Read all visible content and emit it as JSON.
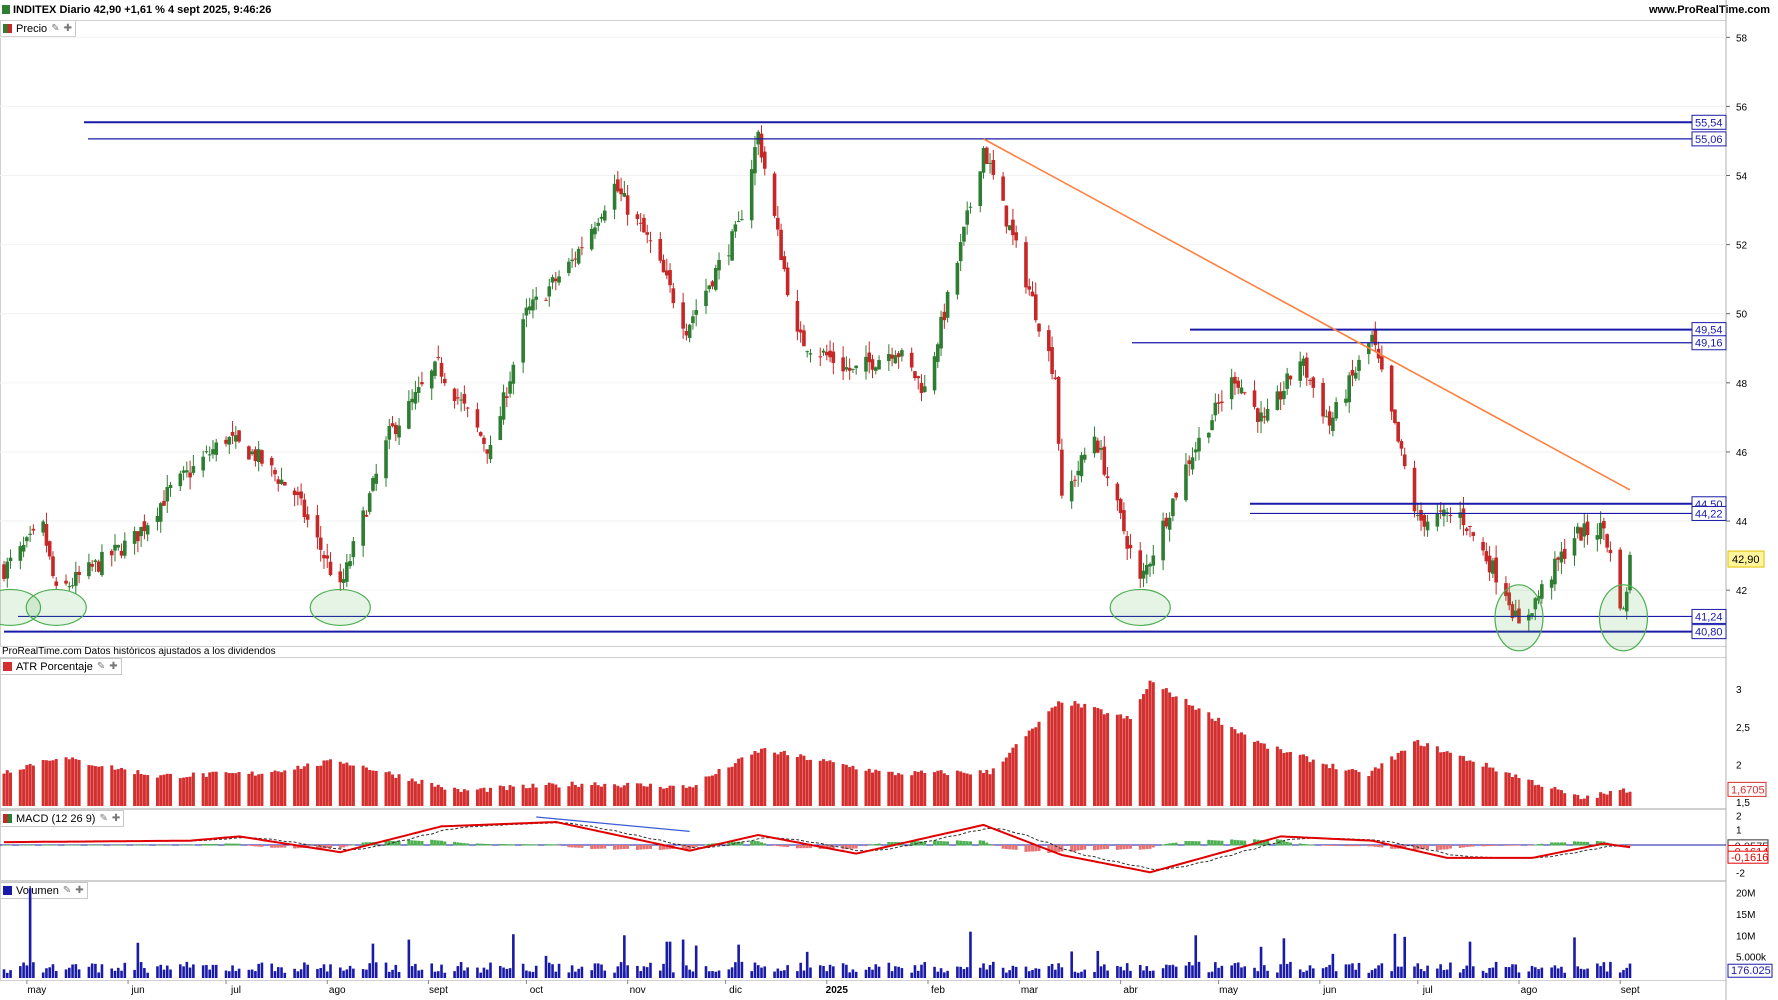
{
  "header": {
    "title": "INDITEX Diario 42,90 +1,61 % 4 sept 2025, 9:46:26",
    "brand": "www.ProRealTime.com"
  },
  "panels": {
    "price_label": "Precio",
    "atr_label": "ATR Porcentaje",
    "macd_label": "MACD (12 26 9)",
    "volume_label": "Volumen",
    "source_note": "ProRealTime.com Datos históricos ajustados a los dividendos"
  },
  "icons": {
    "settings": "wrench-icon",
    "add": "plus-icon"
  },
  "colors": {
    "up": "#2e7d32",
    "down": "#c62828",
    "level": "#1a1aa8",
    "trend": "#ff7f3f",
    "atr": "#d32f2f",
    "volume": "#1a1aa8",
    "support_circle": "#4caf50"
  },
  "x_axis": {
    "labels": [
      "may",
      "jun",
      "jul",
      "ago",
      "sept",
      "oct",
      "nov",
      "dic",
      "2025",
      "feb",
      "mar",
      "abr",
      "may",
      "jun",
      "jul",
      "ago",
      "sept"
    ]
  },
  "price_axis": {
    "ticks": [
      "58",
      "56",
      "54",
      "52",
      "50",
      "48",
      "46",
      "44",
      "42"
    ],
    "level_labels": [
      "55,54",
      "55,06",
      "49,54",
      "49,16",
      "44,50",
      "44,22",
      "41,24",
      "40,80"
    ],
    "current": "42,90"
  },
  "atr_axis": {
    "ticks": [
      "3",
      "2,5",
      "2",
      "1,5"
    ],
    "current": "1,6705"
  },
  "macd_axis": {
    "ticks": [
      "2",
      "1",
      "0",
      "-1",
      "-2"
    ],
    "value_a": "-0,0575",
    "value_b": "-0,1614",
    "value_c": "-0,1616"
  },
  "volume_axis": {
    "ticks": [
      "20M",
      "15M",
      "10M",
      "5.000k"
    ],
    "current": "176.025"
  },
  "chart_data": {
    "type": "candlestick",
    "title": "INDITEX Diario",
    "x_range": [
      "2024-04-24",
      "2025-09-04"
    ],
    "y_range": [
      40.5,
      58.5
    ],
    "levels": [
      55.54,
      55.06,
      49.54,
      49.16,
      44.5,
      44.22,
      41.24,
      40.8
    ],
    "trendline": {
      "from": {
        "date": "2025-02-18",
        "price": 55.06
      },
      "to": {
        "date": "2025-09-04",
        "price": 44.9
      }
    },
    "support_touches": [
      "2024-04-26",
      "2024-05-10",
      "2024-08-05",
      "2025-04-07",
      "2025-08-01",
      "2025-09-02"
    ],
    "close_path": [
      {
        "date": "2024-04-24",
        "close": 42.6
      },
      {
        "date": "2024-05-06",
        "close": 43.8
      },
      {
        "date": "2024-05-10",
        "close": 41.9
      },
      {
        "date": "2024-06-03",
        "close": 43.5
      },
      {
        "date": "2024-06-14",
        "close": 44.9
      },
      {
        "date": "2024-07-01",
        "close": 46.4
      },
      {
        "date": "2024-07-10",
        "close": 45.9
      },
      {
        "date": "2024-07-22",
        "close": 44.8
      },
      {
        "date": "2024-08-05",
        "close": 42.0
      },
      {
        "date": "2024-08-20",
        "close": 46.5
      },
      {
        "date": "2024-09-04",
        "close": 48.5
      },
      {
        "date": "2024-09-20",
        "close": 46.0
      },
      {
        "date": "2024-10-01",
        "close": 50.0
      },
      {
        "date": "2024-10-15",
        "close": 51.5
      },
      {
        "date": "2024-10-28",
        "close": 53.7
      },
      {
        "date": "2024-11-08",
        "close": 52.0
      },
      {
        "date": "2024-11-19",
        "close": 49.6
      },
      {
        "date": "2024-12-05",
        "close": 52.5
      },
      {
        "date": "2024-12-11",
        "close": 55.2
      },
      {
        "date": "2024-12-23",
        "close": 49.3
      },
      {
        "date": "2025-01-09",
        "close": 48.3
      },
      {
        "date": "2025-01-22",
        "close": 49.0
      },
      {
        "date": "2025-01-31",
        "close": 47.8
      },
      {
        "date": "2025-02-10",
        "close": 51.5
      },
      {
        "date": "2025-02-18",
        "close": 54.8
      },
      {
        "date": "2025-03-03",
        "close": 51.0
      },
      {
        "date": "2025-03-12",
        "close": 48.2
      },
      {
        "date": "2025-03-14",
        "close": 44.5
      },
      {
        "date": "2025-03-24",
        "close": 46.5
      },
      {
        "date": "2025-04-07",
        "close": 42.2
      },
      {
        "date": "2025-04-22",
        "close": 45.8
      },
      {
        "date": "2025-05-06",
        "close": 48.2
      },
      {
        "date": "2025-05-15",
        "close": 46.8
      },
      {
        "date": "2025-05-26",
        "close": 48.7
      },
      {
        "date": "2025-06-04",
        "close": 46.8
      },
      {
        "date": "2025-06-17",
        "close": 49.3
      },
      {
        "date": "2025-07-01",
        "close": 44.0
      },
      {
        "date": "2025-07-14",
        "close": 44.2
      },
      {
        "date": "2025-07-28",
        "close": 42.0
      },
      {
        "date": "2025-08-01",
        "close": 40.9
      },
      {
        "date": "2025-08-18",
        "close": 43.6
      },
      {
        "date": "2025-08-27",
        "close": 43.8
      },
      {
        "date": "2025-09-02",
        "close": 41.3
      },
      {
        "date": "2025-09-04",
        "close": 42.9
      }
    ],
    "atr_percent_path": [
      {
        "date": "2024-04-24",
        "value": 1.9
      },
      {
        "date": "2024-05-10",
        "value": 2.1
      },
      {
        "date": "2024-06-10",
        "value": 1.85
      },
      {
        "date": "2024-07-10",
        "value": 1.88
      },
      {
        "date": "2024-08-05",
        "value": 2.05
      },
      {
        "date": "2024-09-10",
        "value": 1.65
      },
      {
        "date": "2024-10-20",
        "value": 1.75
      },
      {
        "date": "2024-11-20",
        "value": 1.7
      },
      {
        "date": "2024-12-12",
        "value": 2.2
      },
      {
        "date": "2025-01-20",
        "value": 1.88
      },
      {
        "date": "2025-02-20",
        "value": 1.9
      },
      {
        "date": "2025-03-14",
        "value": 2.85
      },
      {
        "date": "2025-04-04",
        "value": 2.6
      },
      {
        "date": "2025-04-10",
        "value": 3.1
      },
      {
        "date": "2025-05-15",
        "value": 2.25
      },
      {
        "date": "2025-06-15",
        "value": 1.85
      },
      {
        "date": "2025-07-01",
        "value": 2.3
      },
      {
        "date": "2025-07-31",
        "value": 1.85
      },
      {
        "date": "2025-08-20",
        "value": 1.55
      },
      {
        "date": "2025-09-04",
        "value": 1.67
      }
    ],
    "macd_path": [
      {
        "date": "2024-04-24",
        "macd": 0.2
      },
      {
        "date": "2024-06-20",
        "macd": 0.3
      },
      {
        "date": "2024-07-05",
        "macd": 0.6
      },
      {
        "date": "2024-08-05",
        "macd": -0.5
      },
      {
        "date": "2024-09-05",
        "macd": 1.3
      },
      {
        "date": "2024-10-10",
        "macd": 1.6
      },
      {
        "date": "2024-11-20",
        "macd": -0.4
      },
      {
        "date": "2024-12-11",
        "macd": 0.7
      },
      {
        "date": "2025-01-10",
        "macd": -0.6
      },
      {
        "date": "2025-02-18",
        "macd": 1.4
      },
      {
        "date": "2025-03-14",
        "macd": -0.7
      },
      {
        "date": "2025-04-10",
        "macd": -1.9
      },
      {
        "date": "2025-05-20",
        "macd": 0.6
      },
      {
        "date": "2025-06-17",
        "macd": 0.3
      },
      {
        "date": "2025-07-10",
        "macd": -0.9
      },
      {
        "date": "2025-08-05",
        "macd": -0.9
      },
      {
        "date": "2025-08-27",
        "macd": 0.1
      },
      {
        "date": "2025-09-04",
        "macd": -0.16
      }
    ]
  }
}
